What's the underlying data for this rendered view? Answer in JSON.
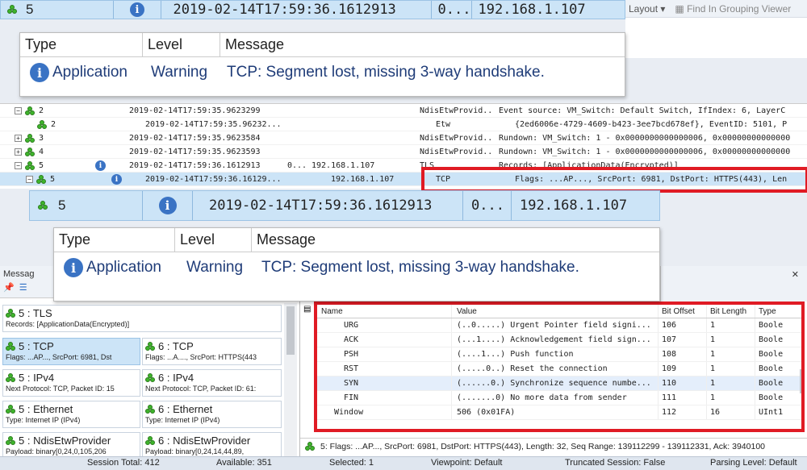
{
  "zoom_top": {
    "id": "5",
    "time": "2019-02-14T17:59:36.1612913",
    "trunc": "0...",
    "ip": "192.168.1.107"
  },
  "top_right": {
    "layout": "Layout",
    "find": "Find In Grouping Viewer"
  },
  "popup": {
    "headers": [
      "Type",
      "Level",
      "Message"
    ],
    "row": {
      "type": "Application",
      "level": "Warning",
      "message": "TCP: Segment lost, missing 3-way handshake."
    }
  },
  "frames": [
    {
      "id": "2",
      "time": "2019-02-14T17:59:35.9623299",
      "ip": "",
      "source": "NdisEtwProvid...",
      "summary": "Event source: VM_Switch: Default Switch, IfIndex: 6, LayerC"
    },
    {
      "id": "2",
      "time": "2019-02-14T17:59:35.96232...",
      "ip": "",
      "source": "Etw",
      "summary": "{2ed6006e-4729-4609-b423-3ee7bcd678ef}, EventID: 5101, P"
    },
    {
      "id": "3",
      "time": "2019-02-14T17:59:35.9623584",
      "ip": "",
      "source": "NdisEtwProvid...",
      "summary": "Rundown: VM_Switch: 1 - 0x0000000000000006, 0x00000000000000"
    },
    {
      "id": "4",
      "time": "2019-02-14T17:59:35.9623593",
      "ip": "",
      "source": "NdisEtwProvid...",
      "summary": "Rundown: VM_Switch: 1 - 0x0000000000000006, 0x00000000000000"
    },
    {
      "id": "5",
      "time": "2019-02-14T17:59:36.1612913",
      "trunc": "0...",
      "ip": "192.168.1.107",
      "source": "TLS",
      "summary": "Records: [ApplicationData(Encrypted)]"
    },
    {
      "id": "5",
      "time": "2019-02-14T17:59:36.16129...",
      "ip": "192.168.1.107",
      "source": "TCP",
      "summary": "Flags: ...AP..., SrcPort: 6981, DstPort: HTTPS(443), Len"
    }
  ],
  "left_pane": {
    "title": "Messag",
    "cards": [
      {
        "title": "5 : TLS",
        "detail": "Records: [ApplicationData(Encrypted)]"
      },
      {
        "title": "5 : TCP",
        "detail": "Flags: ...AP..., SrcPort: 6981, Dst"
      },
      {
        "title": "6 : TCP",
        "detail": "Flags: ...A...., SrcPort: HTTPS(443"
      },
      {
        "title": "5 : IPv4",
        "detail": "Next Protocol: TCP, Packet ID: 15"
      },
      {
        "title": "6 : IPv4",
        "detail": "Next Protocol: TCP, Packet ID: 61:"
      },
      {
        "title": "5 : Ethernet",
        "detail": "Type: Internet IP (IPv4)"
      },
      {
        "title": "6 : Ethernet",
        "detail": "Type: Internet IP (IPv4)"
      },
      {
        "title": "5 : NdisEtwProvider",
        "detail": "Payload: binary[0,24,0,105,206"
      },
      {
        "title": "6 : NdisEtwProvider",
        "detail": "Payload: binary[0,24,14,44,89,"
      }
    ]
  },
  "details": {
    "headers": [
      "Name",
      "Value",
      "Bit Offset",
      "Bit Length",
      "Type"
    ],
    "rows": [
      {
        "name": "URG",
        "value": "(..0.....) Urgent Pointer field signi...",
        "offset": "106",
        "length": "1",
        "type": "Boole"
      },
      {
        "name": "ACK",
        "value": "(...1....) Acknowledgement field sign...",
        "offset": "107",
        "length": "1",
        "type": "Boole"
      },
      {
        "name": "PSH",
        "value": "(....1...) Push function",
        "offset": "108",
        "length": "1",
        "type": "Boole"
      },
      {
        "name": "RST",
        "value": "(.....0..) Reset the connection",
        "offset": "109",
        "length": "1",
        "type": "Boole"
      },
      {
        "name": "SYN",
        "value": "(......0.) Synchronize sequence numbe...",
        "offset": "110",
        "length": "1",
        "type": "Boole"
      },
      {
        "name": "FIN",
        "value": "(.......0) No more data from sender",
        "offset": "111",
        "length": "1",
        "type": "Boole"
      },
      {
        "name": "Window",
        "value": "506 (0x01FA)",
        "offset": "112",
        "length": "16",
        "type": "UInt1"
      }
    ],
    "summary": "5: Flags: ...AP..., SrcPort: 6981, DstPort: HTTPS(443), Length: 32, Seq Range: 139112299 - 139112331, Ack: 3940100"
  },
  "status": {
    "session_total": "Session Total: 412",
    "available": "Available: 351",
    "selected": "Selected: 1",
    "viewpoint": "Viewpoint: Default",
    "truncated": "Truncated Session: False",
    "parsing": "Parsing Level: Default"
  },
  "colors": {
    "selection": "#cce4f7",
    "highlight_border": "#e01b24",
    "info_icon": "#3a73c4",
    "node_icon": "#3fb52c"
  }
}
